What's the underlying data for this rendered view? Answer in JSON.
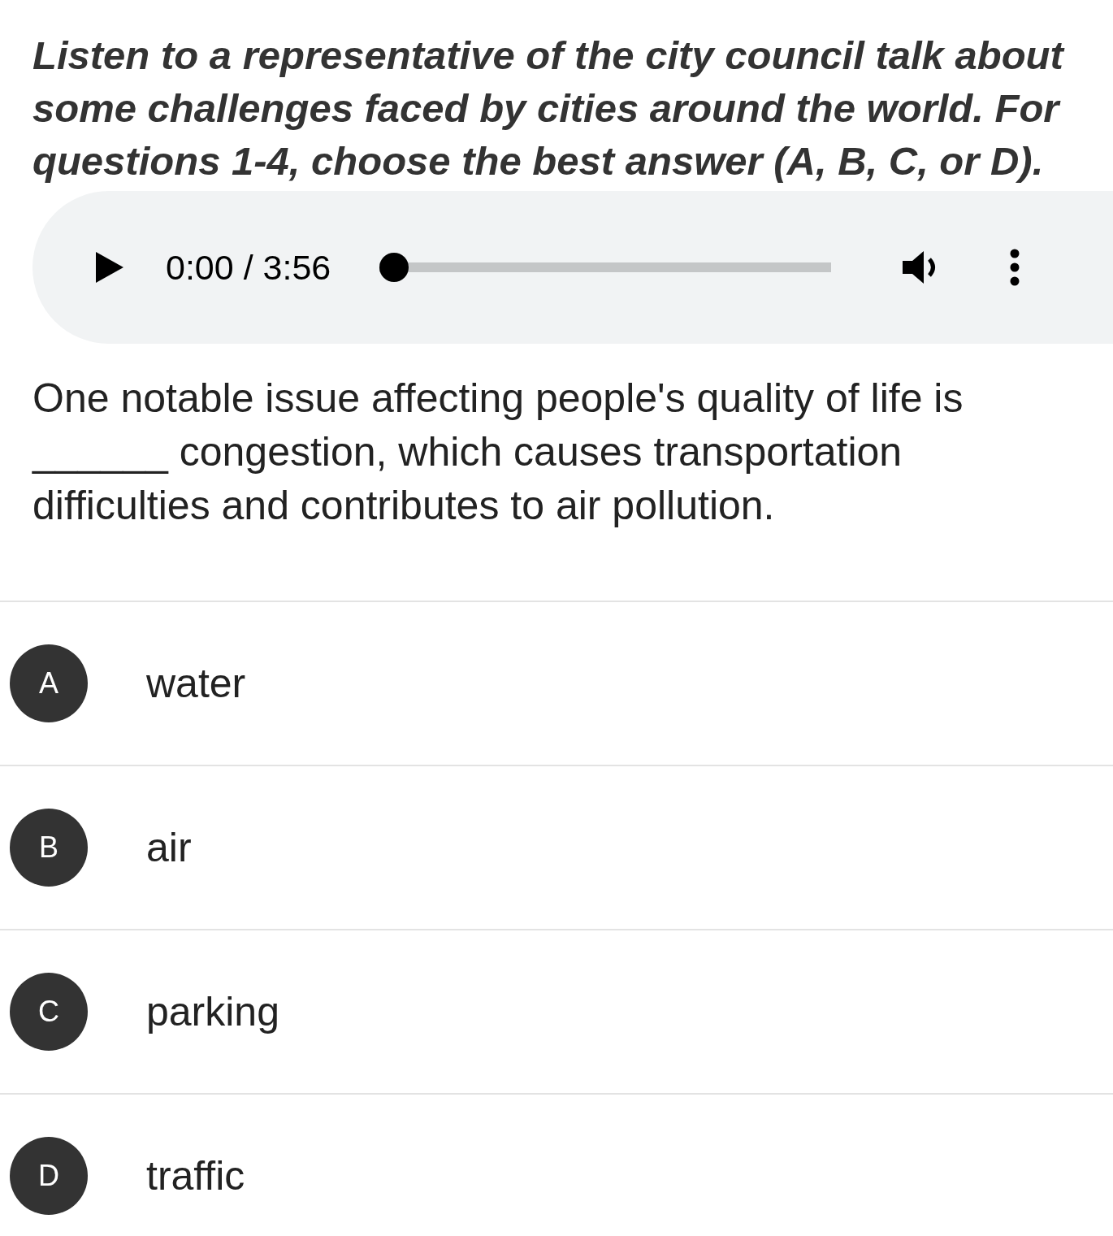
{
  "instructions": "Listen to a representative of the city council talk about some challenges faced by cities around the world. For questions 1-4, choose the best answer (A, B, C, or D).",
  "audio_player": {
    "time": "0:00 / 3:56",
    "level": 0
  },
  "question": {
    "blank": "______",
    "text": "congestion, which causes transportation difficulties and contributes to air pollution.",
    "lead": "One notable issue affecting people's quality of life is"
  },
  "options": [
    {
      "letter": "A",
      "text": "water"
    },
    {
      "letter": "B",
      "text": "air"
    },
    {
      "letter": "C",
      "text": "parking"
    },
    {
      "letter": "D",
      "text": "traffic"
    }
  ]
}
